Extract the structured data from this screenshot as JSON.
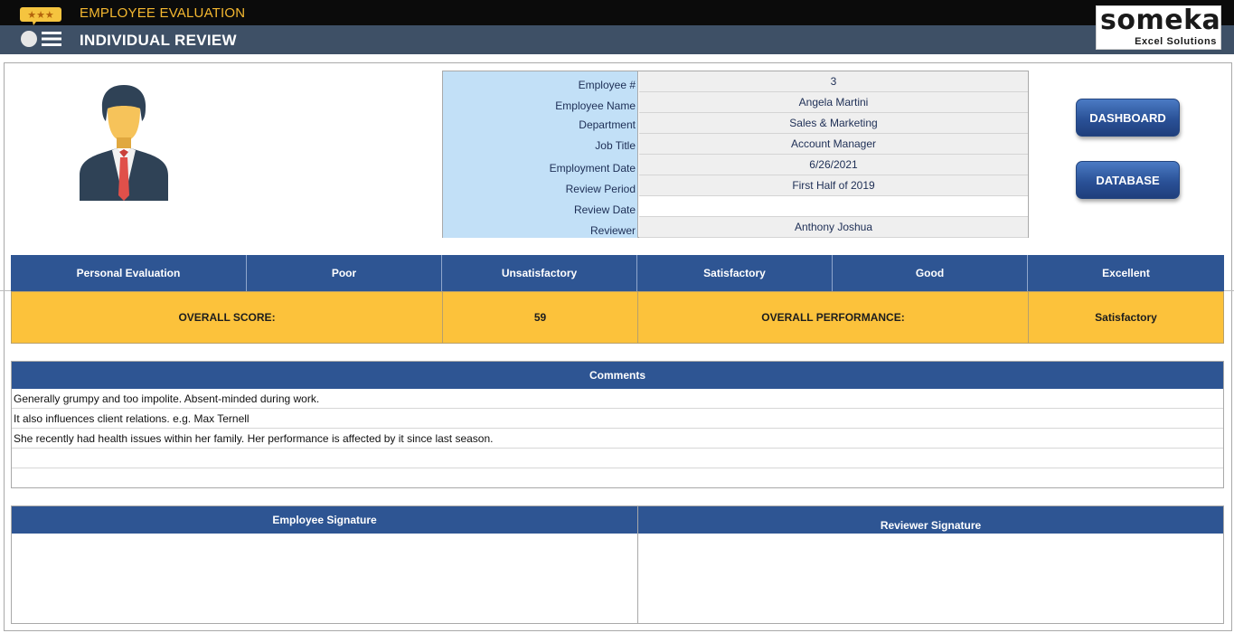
{
  "header": {
    "app_title": "EMPLOYEE EVALUATION",
    "page_title": "INDIVIDUAL REVIEW",
    "icons": {
      "rating": "stars-icon",
      "menu": "toggle-menu-icon",
      "profile": "person-avatar-icon"
    }
  },
  "logo": {
    "name": "someka",
    "tagline": "Excel Solutions"
  },
  "employee_info": [
    {
      "label": "Employee #",
      "value": "3"
    },
    {
      "label": "Employee Name",
      "value": "Angela Martini"
    },
    {
      "label": "Department",
      "value": "Sales & Marketing"
    },
    {
      "label": "Job Title",
      "value": "Account Manager"
    },
    {
      "label": "Employment Date",
      "value": "6/26/2021"
    },
    {
      "label": "Review Period",
      "value": "First Half of 2019"
    },
    {
      "label": "Review Date",
      "value": ""
    },
    {
      "label": "Reviewer",
      "value": "Anthony Joshua"
    }
  ],
  "buttons": {
    "dashboard": "DASHBOARD",
    "database": "DATABASE"
  },
  "evaluation_scale": [
    "Personal Evaluation",
    "Poor",
    "Unsatisfactory",
    "Satisfactory",
    "Good",
    "Excellent"
  ],
  "score": {
    "overall_score_label": "OVERALL SCORE:",
    "overall_score": "59",
    "overall_performance_label": "OVERALL PERFORMANCE:",
    "overall_performance": "Satisfactory"
  },
  "comments": {
    "title": "Comments",
    "lines": [
      "Generally grumpy and too impolite. Absent-minded during work.",
      "It also influences client relations. e.g. Max Ternell",
      "She recently had health issues within her family. Her performance is affected by it since last season.",
      "",
      ""
    ]
  },
  "signatures": {
    "employee": "Employee Signature",
    "reviewer": "Reviewer Signature"
  },
  "colors": {
    "header_bar": "#0b0b0b",
    "subheader_bar": "#3e5066",
    "accent_gold": "#f5b830",
    "table_blue": "#2e5593",
    "label_blue": "#c2e0f7",
    "score_yellow": "#fcc23b"
  }
}
